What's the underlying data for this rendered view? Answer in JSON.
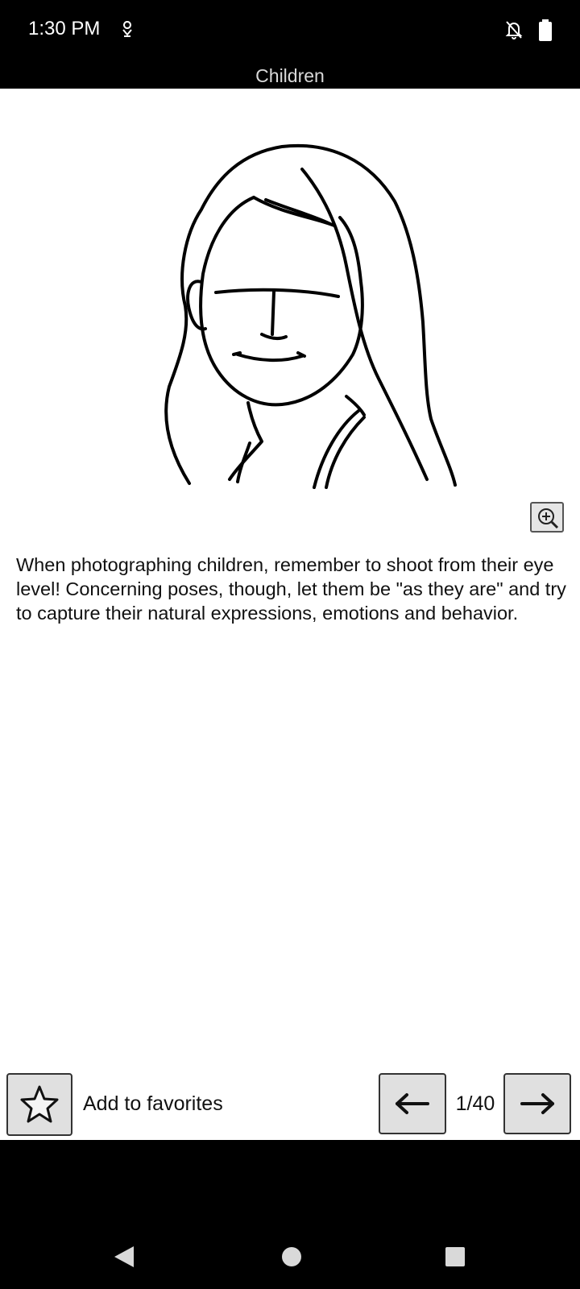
{
  "status_bar": {
    "time": "1:30 PM",
    "icons": [
      "location-pin-icon",
      "notifications-off-icon",
      "battery-icon"
    ]
  },
  "header": {
    "title": "Children"
  },
  "main": {
    "illustration": "sketch-portrait-girl",
    "zoom_icon": "zoom-in-icon",
    "tip": "When photographing children, remember to shoot from their eye level! Concerning poses, though, let them be \"as they are\" and try to capture their natural expressions, emotions and behavior."
  },
  "bottom_bar": {
    "favorite_icon": "star-icon",
    "favorite_label": "Add to favorites",
    "prev_icon": "arrow-left-icon",
    "page_indicator": "1/40",
    "next_icon": "arrow-right-icon"
  },
  "nav_bar": {
    "icons": [
      "back-icon",
      "home-icon",
      "recents-icon"
    ]
  }
}
